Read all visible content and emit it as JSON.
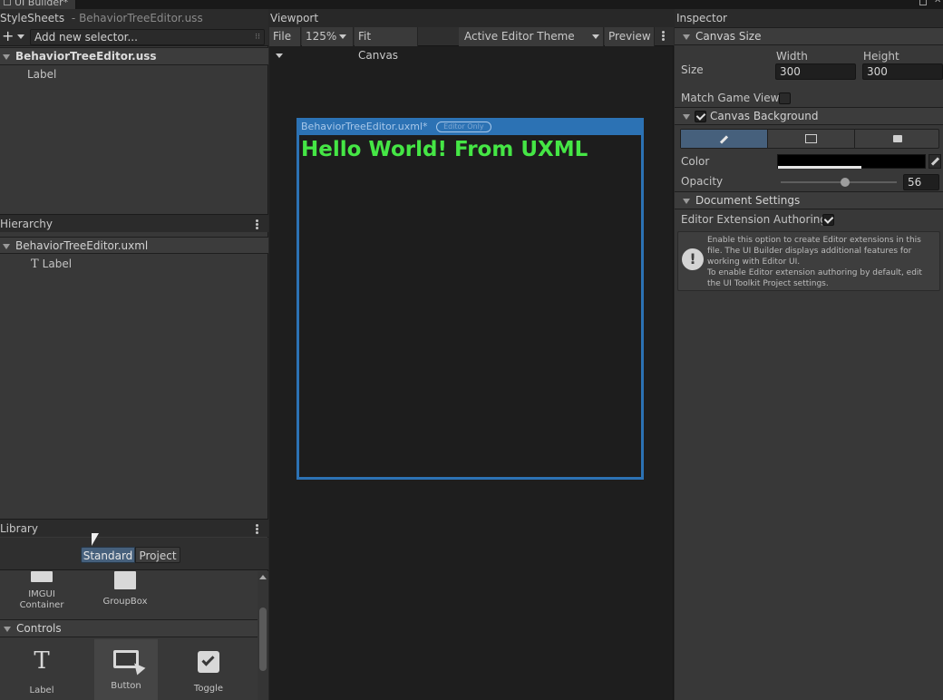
{
  "window": {
    "tab_title": "UI Builder*"
  },
  "stylesheets": {
    "title": "StyleSheets",
    "subtitle": "- BehaviorTreeEditor.uss",
    "add_icon": "plus-icon",
    "selector_placeholder": "Add new selector...",
    "file": "BehaviorTreeEditor.uss",
    "items": [
      "Label"
    ]
  },
  "hierarchy": {
    "title": "Hierarchy",
    "file": "BehaviorTreeEditor.uxml",
    "items": [
      {
        "icon": "text-icon",
        "glyph": "T",
        "label": "Label"
      }
    ]
  },
  "library": {
    "title": "Library",
    "tabs": [
      "Standard",
      "Project"
    ],
    "active_tab": "Standard",
    "row1": [
      {
        "label": "IMGUI\nContainer",
        "line1": "IMGUI",
        "line2": "Container"
      },
      {
        "label": "GroupBox"
      }
    ],
    "controls_section": "Controls",
    "controls": [
      {
        "label": "Label",
        "icon": "text-icon",
        "glyph": "T"
      },
      {
        "label": "Button",
        "icon": "button-icon"
      },
      {
        "label": "Toggle",
        "icon": "toggle-icon"
      }
    ]
  },
  "viewport": {
    "title": "Viewport",
    "toolbar": {
      "file": "File",
      "zoom": "125%",
      "fit": "Fit Canvas",
      "theme": "Active Editor Theme",
      "preview": "Preview"
    },
    "canvas": {
      "title": "BehaviorTreeEditor.uxml*",
      "badge": "Editor Only",
      "content_text": "Hello World! From UXML",
      "frame_color": "#2c72b4",
      "text_color": "#45e645"
    }
  },
  "inspector": {
    "title": "Inspector",
    "canvas_size": {
      "section": "Canvas Size",
      "size_label": "Size",
      "width_label": "Width",
      "width_value": "300",
      "height_label": "Height",
      "height_value": "300",
      "match_label": "Match Game View",
      "match_checked": false
    },
    "canvas_background": {
      "section": "Canvas Background",
      "enabled": true,
      "modes": [
        "eyedropper-icon",
        "image-icon",
        "camera-icon"
      ],
      "color_label": "Color",
      "color_value": "#000000",
      "opacity_label": "Opacity",
      "opacity_value": "56"
    },
    "document_settings": {
      "section": "Document Settings",
      "authoring_label": "Editor Extension Authoring",
      "authoring_checked": true,
      "help_line1": "Enable this option to create Editor extensions in this",
      "help_line2": "file. The UI Builder displays additional features for",
      "help_line3": "working with Editor UI.",
      "help_line4": "To enable Editor extension authoring by default, edit",
      "help_line5": "the UI Toolkit Project settings."
    }
  }
}
